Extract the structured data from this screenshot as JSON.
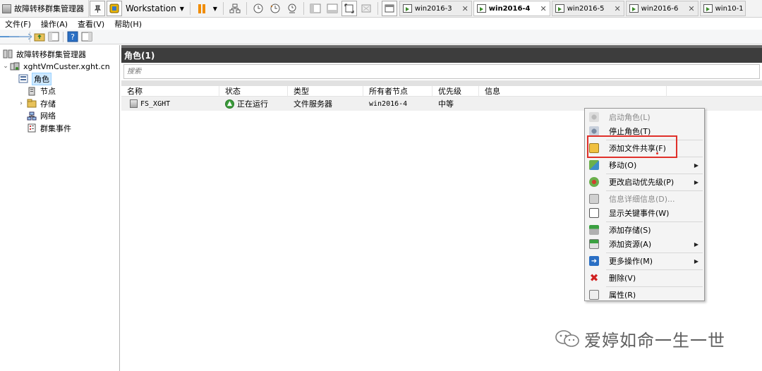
{
  "top_toolbar": {
    "app_title": "故障转移群集管理器",
    "product_label": "Workstation",
    "vm_tabs": [
      {
        "label": "win2016-3",
        "active": false
      },
      {
        "label": "win2016-4",
        "active": true
      },
      {
        "label": "win2016-5",
        "active": false
      },
      {
        "label": "win2016-6",
        "active": false
      },
      {
        "label": "win10-1",
        "active": false
      }
    ],
    "close_glyph": "✕"
  },
  "menu": {
    "file": "文件(F)",
    "action": "操作(A)",
    "view": "查看(V)",
    "help": "帮助(H)"
  },
  "tree": {
    "root": "故障转移群集管理器",
    "cluster": "xghtVmCuster.xght.cn",
    "items": [
      {
        "label": "角色",
        "icon": "roles-icon",
        "selected": true
      },
      {
        "label": "节点",
        "icon": "nodes-icon",
        "selected": false
      },
      {
        "label": "存储",
        "icon": "storage-icon",
        "selected": false
      },
      {
        "label": "网络",
        "icon": "network-icon",
        "selected": false
      },
      {
        "label": "群集事件",
        "icon": "events-icon",
        "selected": false
      }
    ]
  },
  "main": {
    "header": "角色(1)",
    "search_placeholder": "搜索",
    "columns": [
      "名称",
      "状态",
      "类型",
      "所有者节点",
      "优先级",
      "信息"
    ],
    "rows": [
      {
        "name": "FS_XGHT",
        "status": "正在运行",
        "type": "文件服务器",
        "owner": "win2016-4",
        "priority": "中等",
        "info": ""
      }
    ]
  },
  "context_menu": {
    "items": [
      {
        "label": "启动角色(L)",
        "icon": "start-role-icon",
        "disabled": true,
        "submenu": false
      },
      {
        "label": "停止角色(T)",
        "icon": "stop-role-icon",
        "disabled": false,
        "submenu": false
      },
      {
        "sep": true
      },
      {
        "label": "添加文件共享(F)",
        "icon": "add-share-icon",
        "disabled": false,
        "submenu": false
      },
      {
        "sep": true
      },
      {
        "label": "移动(O)",
        "icon": "move-icon",
        "disabled": false,
        "submenu": true
      },
      {
        "sep": true
      },
      {
        "label": "更改启动优先级(P)",
        "icon": "priority-icon",
        "disabled": false,
        "submenu": true
      },
      {
        "sep": true
      },
      {
        "label": "信息详细信息(D)...",
        "icon": "info-details-icon",
        "disabled": true,
        "submenu": false
      },
      {
        "label": "显示关键事件(W)",
        "icon": "critical-events-icon",
        "disabled": false,
        "submenu": false
      },
      {
        "sep": true
      },
      {
        "label": "添加存储(S)",
        "icon": "add-storage-icon",
        "disabled": false,
        "submenu": false
      },
      {
        "label": "添加资源(A)",
        "icon": "add-resource-icon",
        "disabled": false,
        "submenu": true
      },
      {
        "sep": true
      },
      {
        "label": "更多操作(M)",
        "icon": "more-actions-icon",
        "disabled": false,
        "submenu": true
      },
      {
        "sep": true
      },
      {
        "label": "删除(V)",
        "icon": "delete-icon",
        "disabled": false,
        "submenu": false
      },
      {
        "sep": true
      },
      {
        "label": "属性(R)",
        "icon": "properties-icon",
        "disabled": false,
        "submenu": false
      }
    ],
    "submenu_glyph": "▶"
  },
  "watermark": {
    "text": "爱婷如命一生一世"
  },
  "colors": {
    "highlight": "#e0302a",
    "header_bg": "#3d3d3d",
    "selection": "#cde8ff",
    "status_ok": "#3a9a3a",
    "accent_pause": "#f08c00"
  }
}
